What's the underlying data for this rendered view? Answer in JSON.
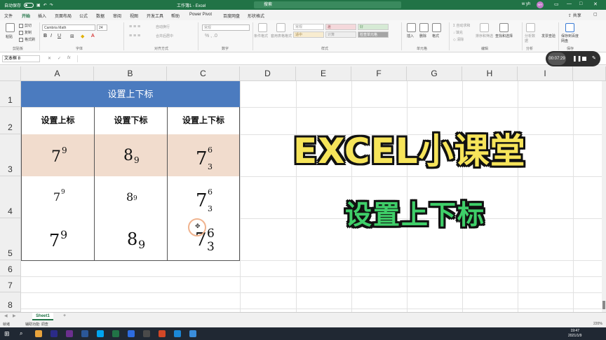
{
  "titlebar": {
    "autosave": "自动保存",
    "doc_title": "工作簿1 - Excel",
    "search_placeholder": "搜索",
    "user": "w yh",
    "avatar": "WY"
  },
  "menu": {
    "tabs": [
      "文件",
      "开始",
      "插入",
      "页面布局",
      "公式",
      "数据",
      "审阅",
      "视图",
      "开发工具",
      "帮助",
      "Power Pivot",
      "百度网盘",
      "形状格式"
    ],
    "share": "共享"
  },
  "ribbon": {
    "paste": "粘贴",
    "cut": "剪切",
    "copy": "复制",
    "format_painter": "格式刷",
    "clipboard": "剪贴板",
    "font_name": "Cambria Math",
    "font_size": "24",
    "font_group": "字体",
    "wrap_text": "自动换行",
    "merge_center": "合并后居中",
    "alignment_group": "对齐方式",
    "number_format": "常规",
    "number_group": "数字",
    "conditional_format": "条件格式",
    "table_format": "套用表格格式",
    "styles": [
      "常规",
      "差",
      "好",
      "适中",
      "计算",
      "检查单元格"
    ],
    "style_group": "样式",
    "insert": "插入",
    "delete": "删除",
    "format": "格式",
    "cells_group": "单元格",
    "autosum": "自动求和",
    "fill": "填充",
    "clear": "清除",
    "sort_filter": "排序和筛选",
    "find_select": "查找和选择",
    "editing_group": "编辑",
    "analyze": "分析数据",
    "analyze_group": "分析",
    "invoice": "发票查验",
    "save_baidu": "保存到百度网盘",
    "save_group": "保存"
  },
  "formula_bar": {
    "name_box": "文本框 8",
    "fx": "fx"
  },
  "recorder": {
    "time": "00:07:29"
  },
  "grid": {
    "columns": [
      "A",
      "B",
      "C",
      "D",
      "E",
      "F",
      "G",
      "H",
      "I"
    ],
    "rows": [
      "1",
      "2",
      "3",
      "4",
      "5",
      "6",
      "7",
      "8"
    ]
  },
  "table": {
    "title": "设置上下标",
    "headers": [
      "设置上标",
      "设置下标",
      "设置上下标"
    ],
    "base_a": "7",
    "sup_a": "9",
    "base_b": "8",
    "sub_b": "9",
    "base_c": "7",
    "sup_c": "6",
    "sub_c": "3"
  },
  "overlay": {
    "title": "EXCEL小课堂",
    "subtitle": "设置上下标"
  },
  "sheet": {
    "tab": "Sheet1",
    "add": "+"
  },
  "status": {
    "ready": "就绪",
    "accessibility": "辅助功能: 调查",
    "zoom": "220%"
  },
  "taskbar": {
    "time": "19:47",
    "date": "2021/1/9"
  }
}
